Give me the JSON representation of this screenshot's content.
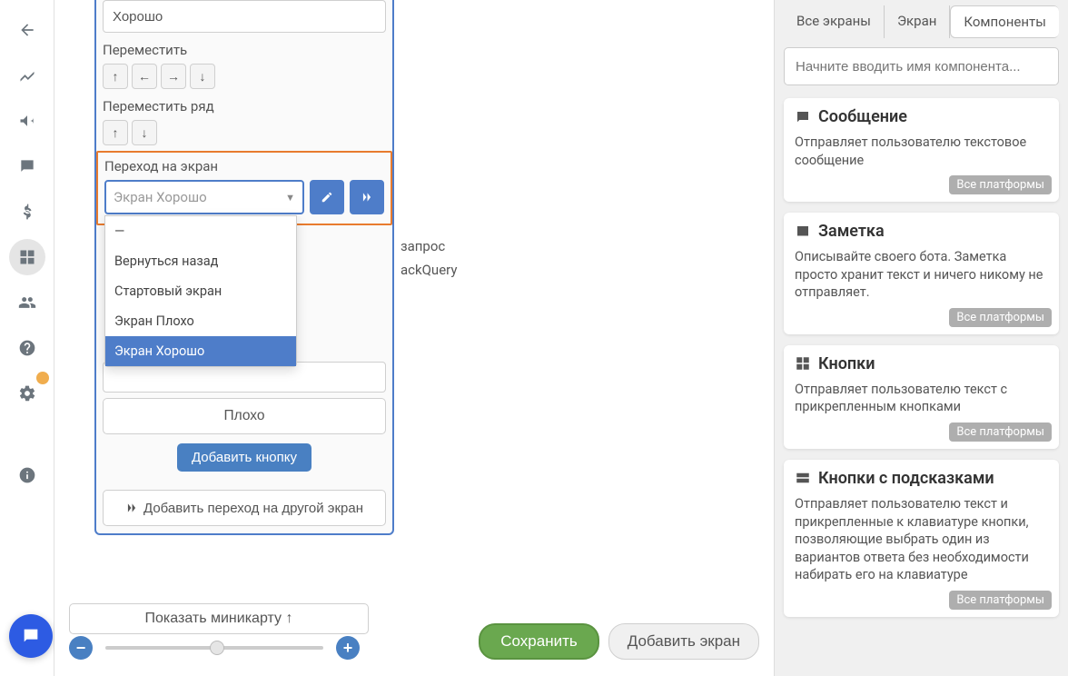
{
  "sidebar_icons": [
    "back",
    "chart",
    "megaphone",
    "chat-dots",
    "dollar",
    "layers",
    "users",
    "help",
    "settings",
    "info"
  ],
  "editor": {
    "name_value": "Хорошо",
    "move_label": "Переместить",
    "move_row_label": "Переместить ряд",
    "goto_label": "Переход на экран",
    "select_value": "Экран Хорошо",
    "dropdown": [
      "—",
      "Вернуться назад",
      "Стартовый экран",
      "Экран Плохо",
      "Экран Хорошо"
    ],
    "dropdown_selected_index": 4,
    "bg_text1": "запрос",
    "bg_text2": "ackQuery",
    "btn_bad": "Плохо",
    "btn_add": "Добавить кнопку",
    "btn_add_transition": "Добавить переход на другой экран"
  },
  "bottom": {
    "minimap": "Показать миникарту ↑",
    "save": "Сохранить",
    "add_screen": "Добавить экран"
  },
  "right": {
    "tabs": [
      "Все экраны",
      "Экран",
      "Компоненты"
    ],
    "active_tab": 2,
    "search_placeholder": "Начните вводить имя компонента...",
    "platform_badge": "Все платформы",
    "components": [
      {
        "icon": "message",
        "title": "Сообщение",
        "desc": "Отправляет пользователю текстовое сообщение"
      },
      {
        "icon": "note",
        "title": "Заметка",
        "desc": "Описывайте своего бота. Заметка просто хранит текст и ничего никому не отправляет."
      },
      {
        "icon": "buttons",
        "title": "Кнопки",
        "desc": "Отправляет пользователю текст с прикрепленным кнопками"
      },
      {
        "icon": "keyboard",
        "title": "Кнопки с подсказками",
        "desc": "Отправляет пользователю текст и прикрепленные к клавиатуре кнопки, позволяющие выбрать один из вариантов ответа без необходимости набирать его на клавиатуре"
      }
    ]
  }
}
